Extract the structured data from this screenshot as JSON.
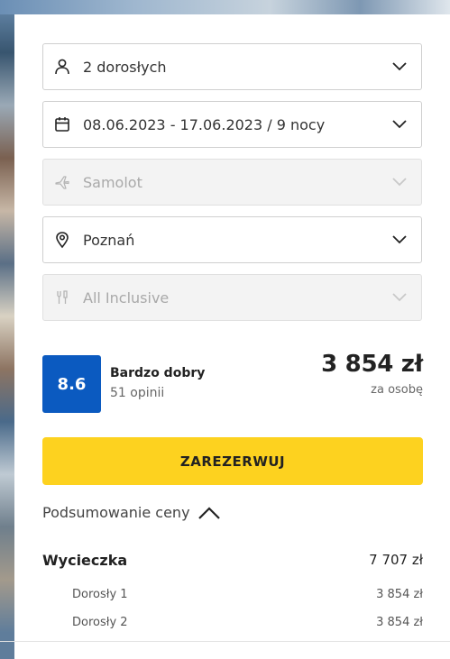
{
  "search": {
    "travelers": {
      "value": "2 dorosłych",
      "icon": "person-icon"
    },
    "dates": {
      "value": "08.06.2023 - 17.06.2023 / 9 nocy",
      "icon": "calendar-icon"
    },
    "transport": {
      "value": "Samolot",
      "icon": "airplane-icon",
      "disabled": true
    },
    "departure": {
      "value": "Poznań",
      "icon": "location-pin-icon"
    },
    "board": {
      "value": "All Inclusive",
      "icon": "cutlery-icon",
      "disabled": true
    }
  },
  "rating": {
    "score": "8.6",
    "label": "Bardzo dobry",
    "reviews": "51 opinii",
    "color": "#0b5ac0"
  },
  "price": {
    "amount": "3 854 zł",
    "per": "za osobę"
  },
  "reserve_button": {
    "label": "ZAREZERWUJ",
    "color": "#fdd21f"
  },
  "summary": {
    "toggle_label": "Podsumowanie ceny",
    "expanded": true,
    "trip": {
      "label": "Wycieczka",
      "value": "7 707 zł"
    },
    "items": [
      {
        "label": "Dorosły 1",
        "value": "3 854 zł"
      },
      {
        "label": "Dorosły 2",
        "value": "3 854 zł"
      }
    ]
  }
}
